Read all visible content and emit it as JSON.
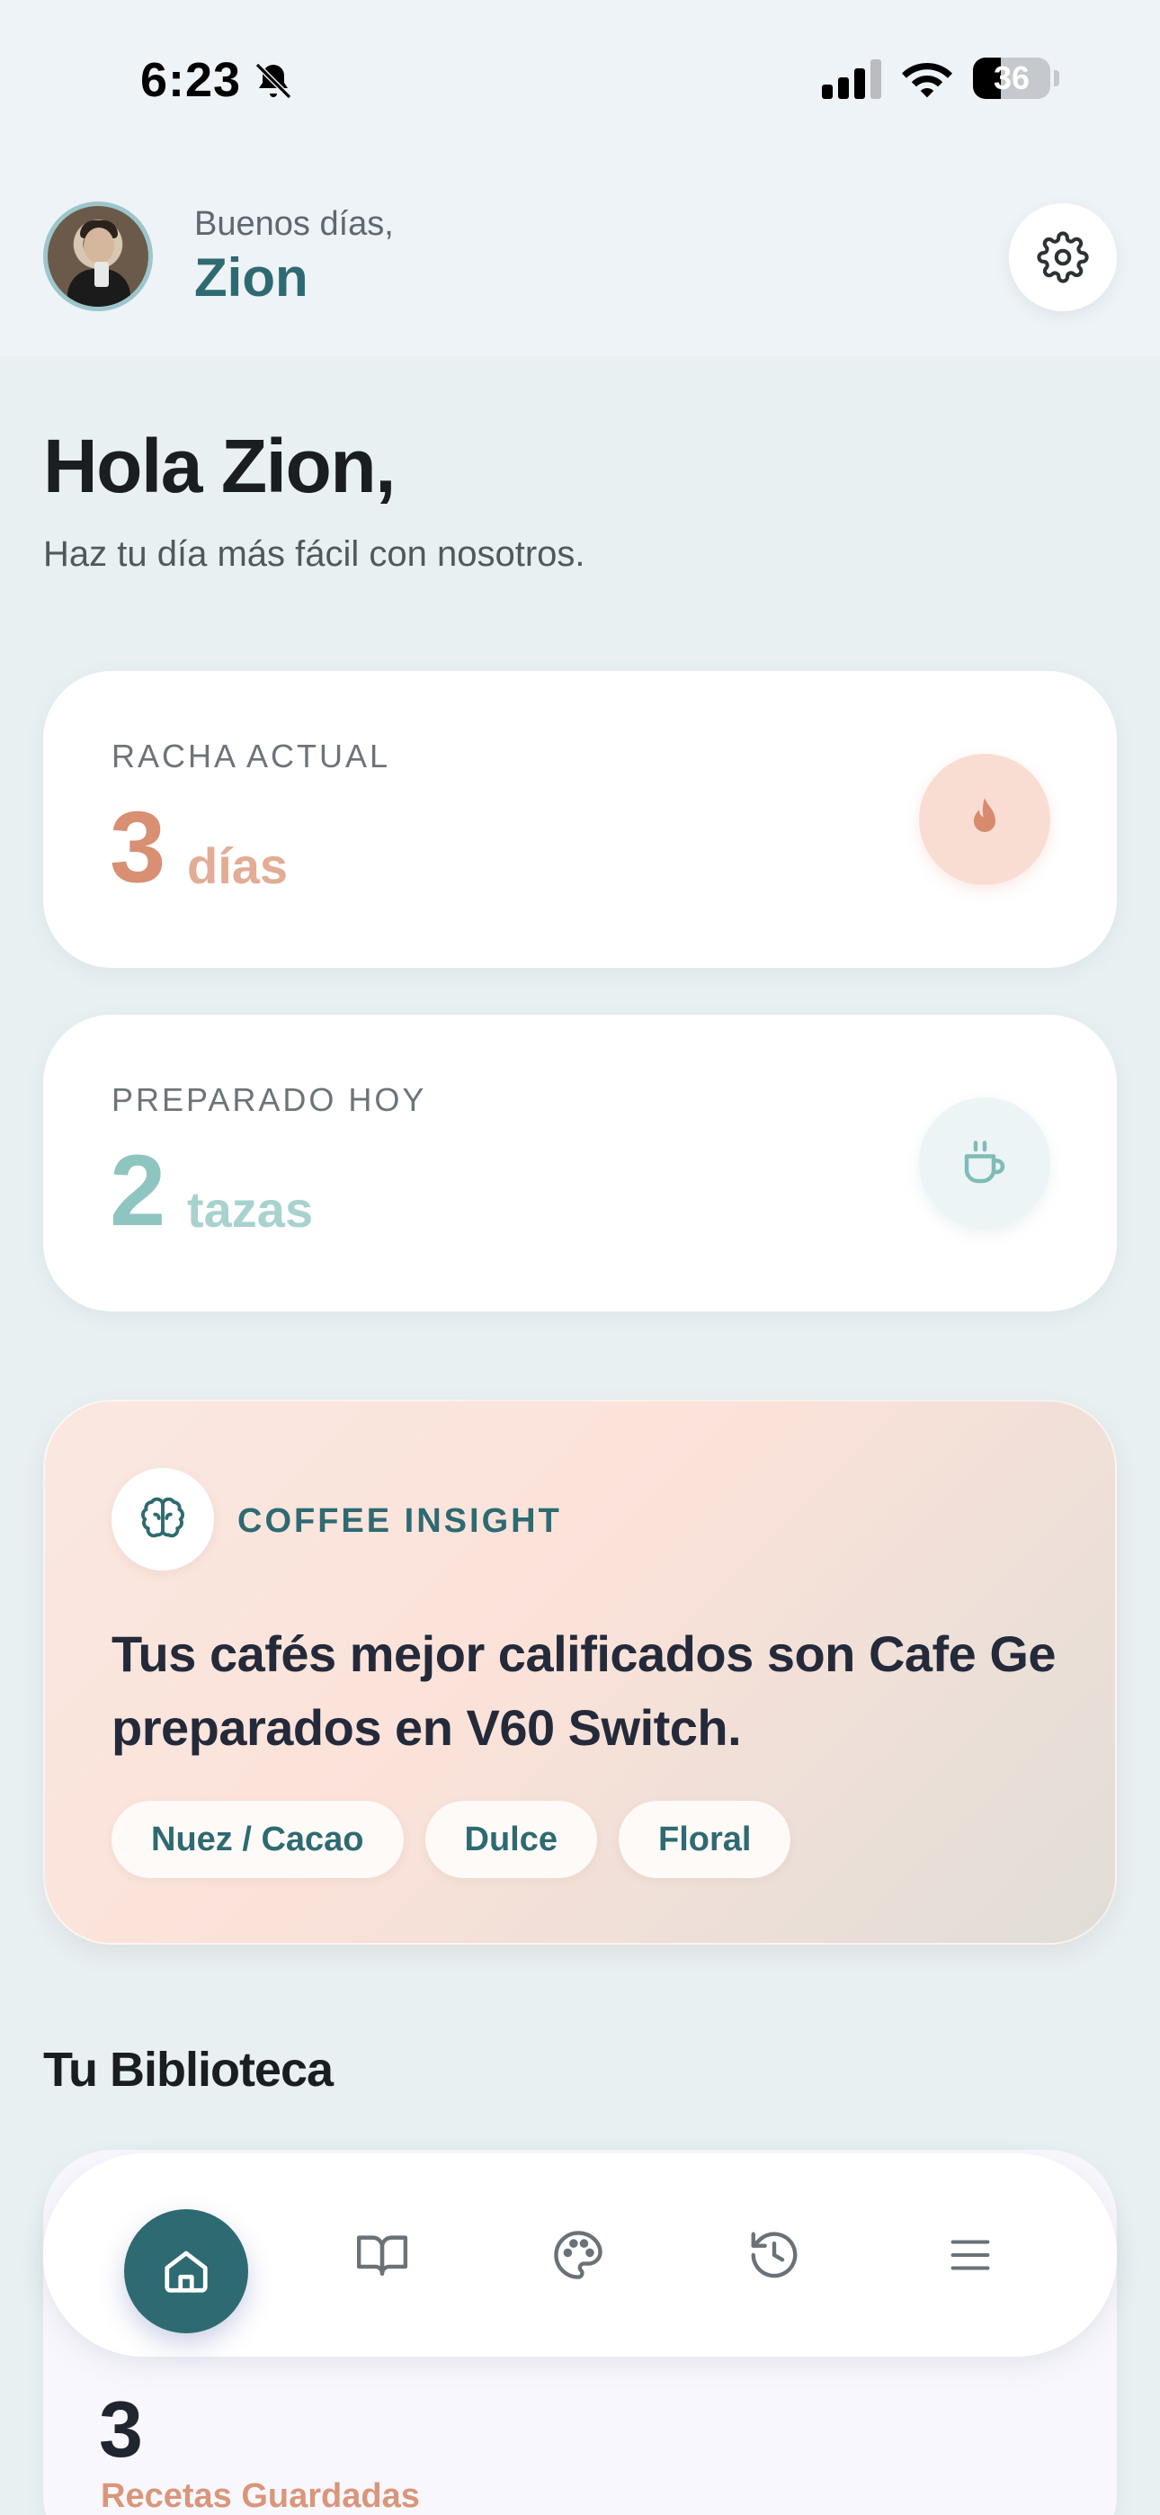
{
  "status_bar": {
    "time": "6:23",
    "battery_level": "36",
    "icons": [
      "bell-slash-icon",
      "signal-icon",
      "wifi-icon",
      "battery-icon"
    ]
  },
  "header": {
    "greeting": "Buenos días,",
    "name": "Zion",
    "settings_icon": "gear-icon"
  },
  "hero": {
    "title": "Hola Zion,",
    "subtitle": "Haz tu día más fácil con nosotros."
  },
  "stats": {
    "streak": {
      "label": "RACHA ACTUAL",
      "value": "3",
      "unit": "días",
      "icon": "flame-icon"
    },
    "brewed": {
      "label": "PREPARADO HOY",
      "value": "2",
      "unit": "tazas",
      "icon": "coffee-cup-icon"
    }
  },
  "insight": {
    "label": "COFFEE INSIGHT",
    "icon": "brain-icon",
    "text": "Tus cafés mejor calificados son Cafe Ge preparados en V60 Switch.",
    "chips": [
      "Nuez / Cacao",
      "Dulce",
      "Floral"
    ]
  },
  "library": {
    "title": "Tu Biblioteca",
    "count": "3",
    "label": "Recetas Guardadas"
  },
  "bottom_nav": {
    "items": [
      "home-icon",
      "book-icon",
      "palette-icon",
      "history-icon",
      "menu-icon"
    ],
    "active": "home-icon"
  },
  "colors": {
    "accent": "#2e6a71",
    "streak": "#d88f72",
    "brewed": "#8fc5c0",
    "library_label": "#d9967a"
  }
}
